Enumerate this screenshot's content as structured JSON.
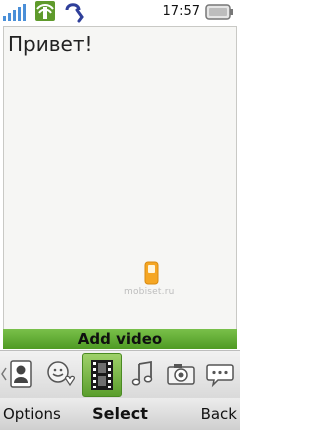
{
  "status_bar": {
    "signal_icon": "signal-strength-icon",
    "gprs_icon": "gprs-icon",
    "bt_icon": "bluetooth-headset-icon",
    "time": "17:57",
    "battery_icon": "battery-icon"
  },
  "editor": {
    "text": "Привет!",
    "watermark": "mobiset.ru"
  },
  "add_video_label": "Add video",
  "icon_bar": {
    "items": [
      "contact-picture-icon",
      "emoticon-icon",
      "video-icon",
      "music-note-icon",
      "camera-icon",
      "chat-bubble-icon"
    ],
    "selected": "video-icon"
  },
  "softkeys": {
    "left": "Options",
    "middle": "Select",
    "right": "Back"
  },
  "colors": {
    "accent_green": "#5f9a2c",
    "bar_green": "#79c04a"
  }
}
